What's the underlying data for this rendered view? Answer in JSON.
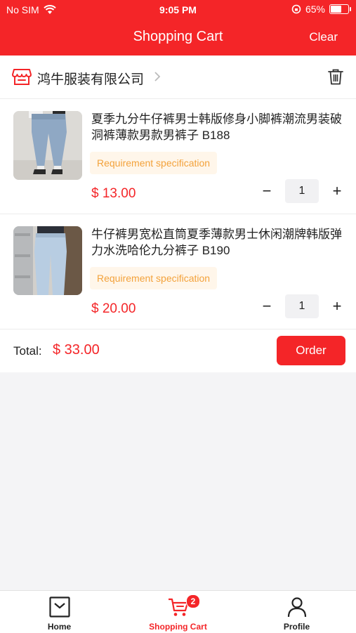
{
  "status_bar": {
    "carrier": "No SIM",
    "time": "9:05 PM",
    "battery": "65%",
    "battery_level": 0.65
  },
  "header": {
    "title": "Shopping Cart",
    "clear_label": "Clear"
  },
  "store": {
    "name": "鸿牛服装有限公司"
  },
  "items": [
    {
      "title": "夏季九分牛仔裤男士韩版修身小脚裤潮流男装破洞裤薄款男款男裤子 B188",
      "spec": "Requirement specification",
      "price": "$ 13.00",
      "quantity": "1"
    },
    {
      "title": "牛仔裤男宽松直筒夏季薄款男士休闲潮牌韩版弹力水洗哈伦九分裤子 B190",
      "spec": "Requirement specification",
      "price": "$ 20.00",
      "quantity": "1"
    }
  ],
  "footer": {
    "total_label": "Total:",
    "total_value": "$ 33.00",
    "order_label": "Order"
  },
  "tabbar": {
    "tabs": [
      {
        "label": "Home",
        "icon": "home-icon"
      },
      {
        "label": "Shopping Cart",
        "icon": "cart-icon",
        "badge": "2"
      },
      {
        "label": "Profile",
        "icon": "profile-icon"
      }
    ]
  },
  "colors": {
    "accent": "#f42528",
    "spec_text": "#f3a23b",
    "spec_bg": "#fff6ea"
  }
}
